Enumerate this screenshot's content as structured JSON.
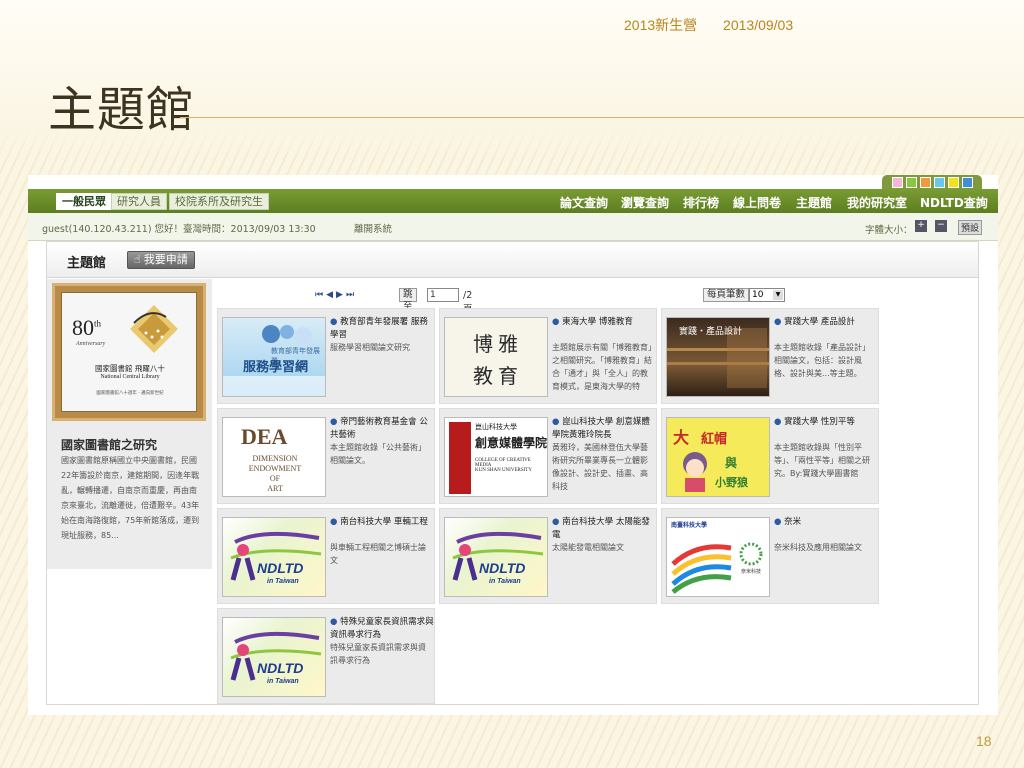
{
  "slide": {
    "header_tag": "2013新生營",
    "date": "2013/09/03",
    "title": "主題館",
    "page_number": "18"
  },
  "theme_colors": [
    "#f2b8d5",
    "#89c641",
    "#f19a3e",
    "#67c8e8",
    "#f2e21b",
    "#3f8fd6"
  ],
  "audience_tabs": [
    {
      "label": "一般民眾",
      "active": true
    },
    {
      "label": "研究人員",
      "active": false
    },
    {
      "label": "校院系所及研究生",
      "active": false
    }
  ],
  "nav_links": [
    "論文查詢",
    "瀏覽查詢",
    "排行榜",
    "線上問卷",
    "主題館",
    "我的研究室",
    "NDLTD查詢"
  ],
  "status": {
    "user_info": "guest(140.120.43.211) 您好！臺灣時間：2013/09/03 13:30",
    "logout": "離開系統",
    "fontsize_label": "字體大小：",
    "fontsize_up": "+",
    "fontsize_down": "−",
    "fontsize_reset": "預設"
  },
  "panel": {
    "title": "主題館",
    "apply_label": "我要申請"
  },
  "sidebar": {
    "logo_number": "80",
    "logo_suffix": "th",
    "logo_anniversary": "Anniversary",
    "logo_zh": "國家圖書館 飛躍八十",
    "logo_en": "National Central Library",
    "logo_tag": "國家圖書館八十週年 · 邁向新世紀",
    "heading": "國家圖書館之研究",
    "description": "國家圖書館原稱國立中央圖書館，民國22年籌設於南京，建館期間，因逢年戰亂，輾轉播遷，自南京而重慶，再由南京來臺北，流離遷徙，倍遭艱辛。43年始在南海路復館，75年新館落成，遷到現址服務，85..."
  },
  "pager": {
    "jump_label": "跳至",
    "page_value": "1",
    "total_pages": "/2頁",
    "per_page_label": "每頁筆數",
    "per_page_value": "10"
  },
  "cards": [
    {
      "title": "教育部青年發展署 服務學習",
      "desc": "服務學習相關論文研究",
      "thumb": "service"
    },
    {
      "title": "東海大學 博雅教育",
      "desc": "主題館展示有關「博雅教育」之相關研究。「博雅教育」結合「通才」與「全人」的教育模式，是東海大學的特",
      "thumb": "boya"
    },
    {
      "title": "實踐大學 產品設計",
      "desc": "本主題館收錄「產品設計」相關論文，包括：設計風格、設計與美...等主題。",
      "thumb": "product"
    },
    {
      "title": "帝門藝術教育基金會 公共藝術",
      "desc": "本主題館收錄「公共藝術」相關論文。",
      "thumb": "dea"
    },
    {
      "title": "崑山科技大學 創意媒體學院黃雅玲院長",
      "desc": "黃雅玲，美國林登伍大學藝術研究所畢業專長一立體影像設計、設計史、插畫、高科技",
      "thumb": "creative"
    },
    {
      "title": "實踐大學 性別平等",
      "desc": "本主題館收錄與「性別平等」、「兩性平等」相關之研究。By:實踐大學圖書館",
      "thumb": "gender"
    },
    {
      "title": "南台科技大學 車輛工程",
      "desc": "與車輛工程相關之博碩士論文",
      "thumb": "ndltd"
    },
    {
      "title": "南台科技大學 太陽能發電",
      "desc": "太陽能發電相關論文",
      "thumb": "ndltd"
    },
    {
      "title": "奈米",
      "desc": "奈米科技及應用相關論文",
      "thumb": "nano"
    },
    {
      "title": "特殊兒童家長資訊需求與資訊尋求行為",
      "desc": "特殊兒童家長資訊需求與資訊尋求行為",
      "thumb": "ndltd"
    }
  ],
  "thumbs": {
    "service_top": "教育部青年發展署",
    "service_main": "服務學習網",
    "boya_1": "博 雅",
    "boya_2": "教 育",
    "product_label": "實踐・產品設計",
    "dea_main": "DEA",
    "dea_sub1": "DIMENSION",
    "dea_sub2": "ENDOWMENT",
    "dea_sub3": "OF",
    "dea_sub4": "ART",
    "creative_school": "崑山科技大學",
    "creative_name": "創意媒體學院",
    "creative_en1": "COLLEGE OF CREATIVE MEDIA",
    "creative_en2": "KUN SHAN UNIVERSITY",
    "gender_1": "大",
    "gender_2": "紅帽",
    "gender_3": "與",
    "gender_4": "小野狼",
    "ndltd_text": "NDLTD",
    "ndltd_sub": "in Taiwan",
    "nano_school": "南臺科技大學",
    "nano_label": "奈米科技"
  }
}
